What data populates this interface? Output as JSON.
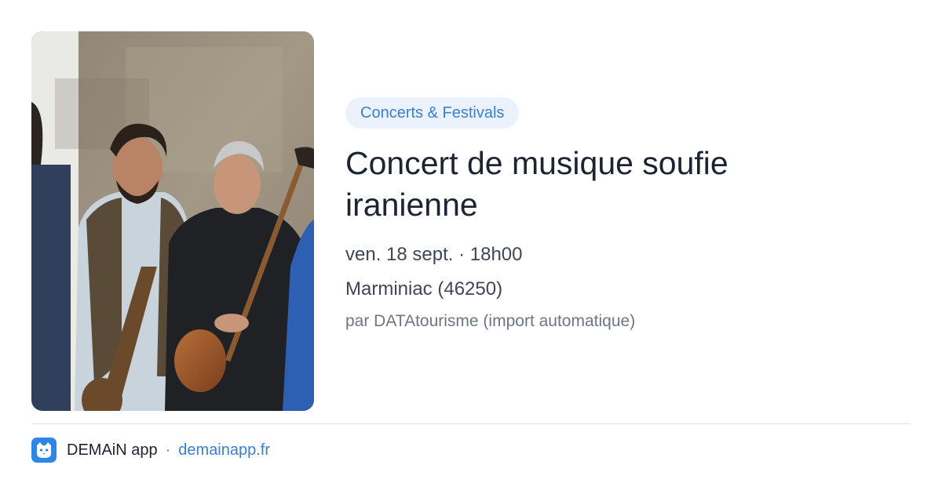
{
  "event": {
    "image_alt": "Musiciens avec instruments à cordes",
    "category": "Concerts & Festivals",
    "title": "Concert de musique soufie iranienne",
    "datetime": "ven. 18 sept. · 18h00",
    "location": "Marminiac (46250)",
    "organizer": "par DATAtourisme (import automatique)"
  },
  "footer": {
    "app_name": "DEMAiN app",
    "separator": "·",
    "link": "demainapp.fr",
    "logo_icon": "cat-face-icon"
  },
  "colors": {
    "accent": "#3b7fd0",
    "chip_bg": "#ebf2fc",
    "title": "#1c2333",
    "muted": "#6c7684",
    "logo_bg": "#2e86e6"
  }
}
